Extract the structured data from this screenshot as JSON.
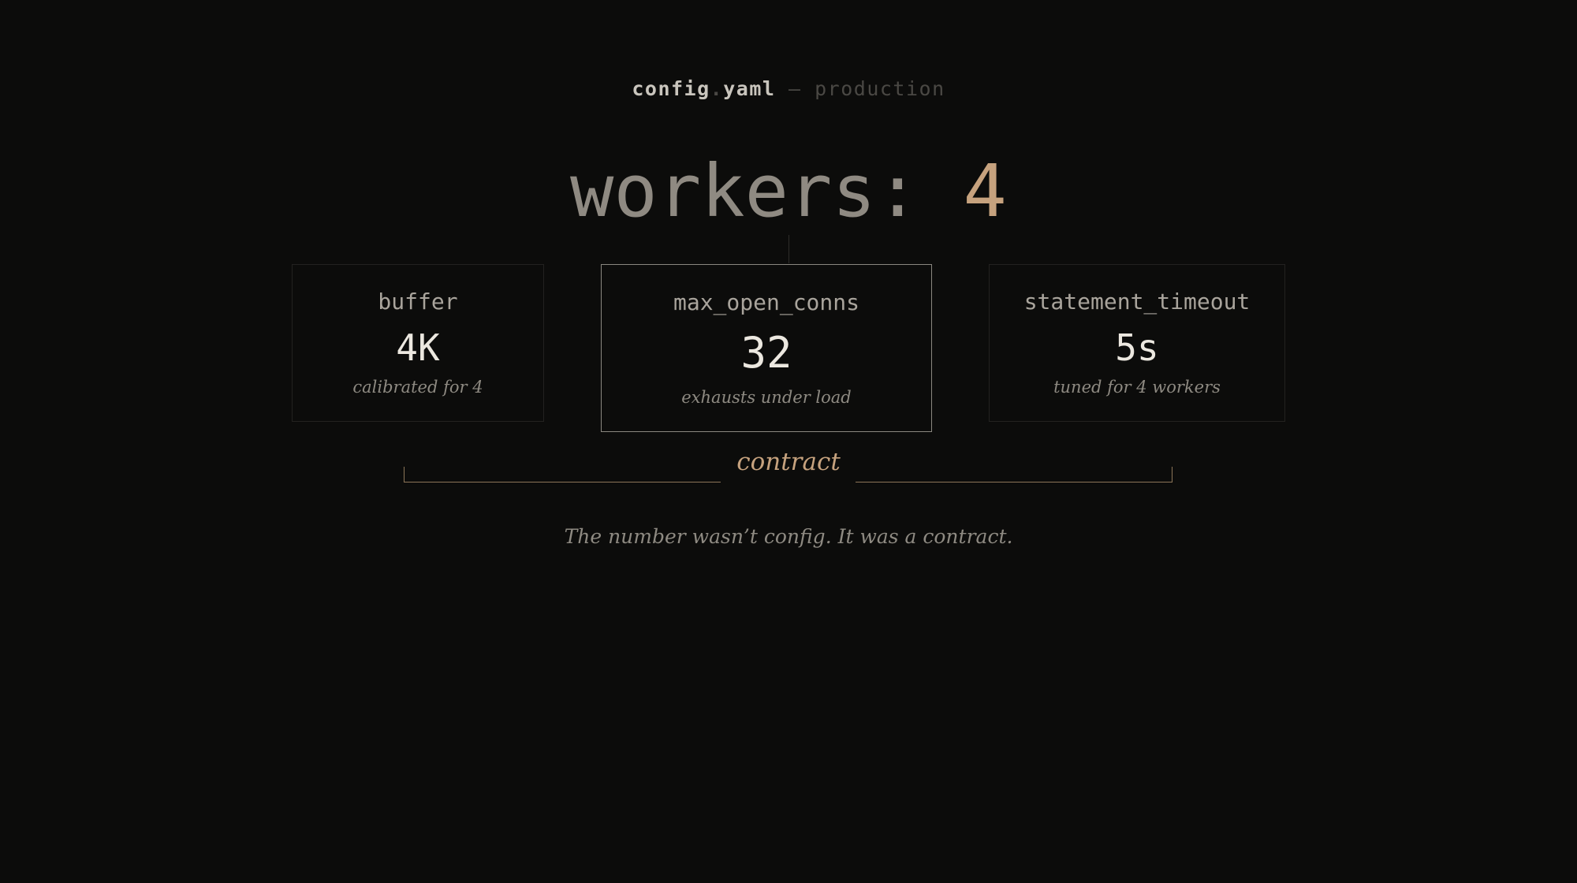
{
  "header": {
    "file_base": "config",
    "file_dot": ".",
    "file_ext": "yaml",
    "separator": "—",
    "environment": "production"
  },
  "headline": {
    "key": "workers: ",
    "value": "4"
  },
  "cards": [
    {
      "key": "buffer",
      "value": "4K",
      "note": "calibrated for 4"
    },
    {
      "key": "max_open_conns",
      "value": "32",
      "note": "exhausts under load"
    },
    {
      "key": "statement_timeout",
      "value": "5s",
      "note": "tuned for 4 workers"
    }
  ],
  "bracket_label": "contract",
  "caption": "The number wasn’t config. It was a contract.",
  "colors": {
    "background": "#0c0c0b",
    "accent": "#c6a27e",
    "text_primary": "#ece8e0",
    "text_muted": "#8e8a82"
  }
}
